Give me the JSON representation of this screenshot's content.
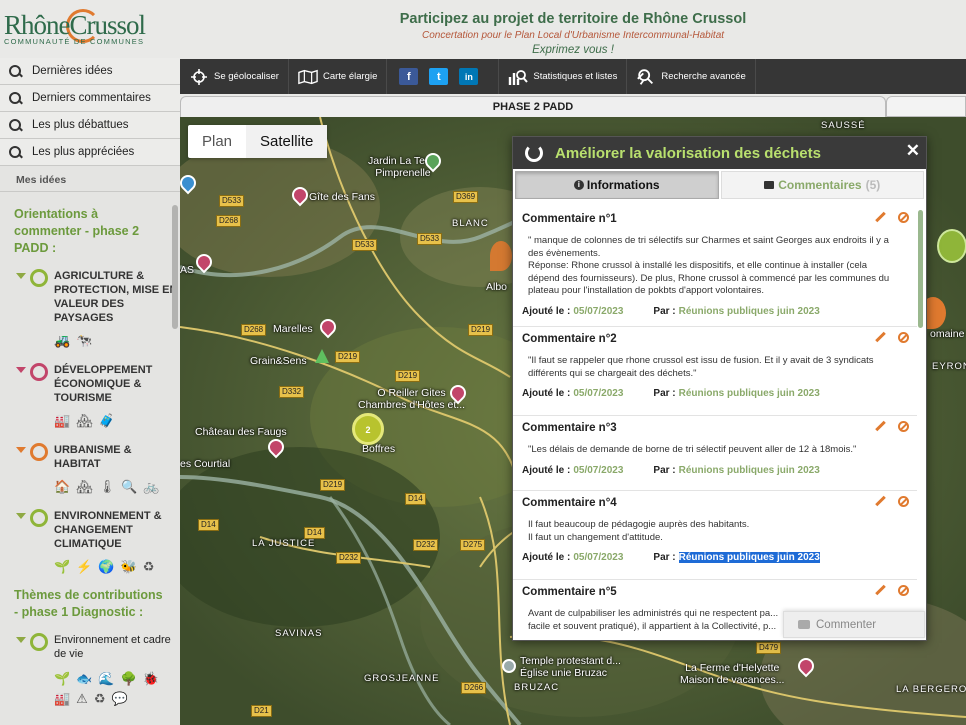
{
  "logo": {
    "brand": "RhôneCrussol",
    "sub": "COMMUNAUTÉ DE COMMUNES"
  },
  "header": {
    "title": "Participez au projet de territoire de Rhône Crussol",
    "subtitle": "Concertation pour le Plan Local d'Urbanisme Intercommunal-Habitat",
    "tagline": "Exprimez vous !"
  },
  "sidebar": {
    "menu": [
      "Dernières idées",
      "Derniers commentaires",
      "Les plus débattues",
      "Les plus appréciées"
    ],
    "mes_idees": "Mes idées",
    "section1_title": "Orientations à commenter - phase 2 PADD :",
    "section1_items": [
      {
        "label": "AGRICULTURE & PROTECTION, MISE EN VALEUR DES PAYSAGES",
        "color": "#8fb539",
        "icons": "🚜🐄"
      },
      {
        "label": "DÉVELOPPEMENT ÉCONOMIQUE & TOURISME",
        "color": "#c2456a",
        "icons": "🏭🏘🧳"
      },
      {
        "label": "URBANISME & HABITAT",
        "color": "#e07a2f",
        "icons": "🏠🏘🌡🔍🚲"
      },
      {
        "label": "ENVIRONNEMENT & CHANGEMENT CLIMATIQUE",
        "color": "#8fb539",
        "icons": "🌱⚡🌍🐝♻"
      }
    ],
    "section2_title": "Thèmes de contributions - phase 1 Diagnostic :",
    "section2_items": [
      {
        "label": "Environnement et cadre de vie",
        "color": "#8fb539",
        "icons": "🌱🐟🌊🌳🐞\n🏭⚠♻💬"
      }
    ]
  },
  "toolbar": {
    "geolocate": "Se géolocaliser",
    "carte": "Carte élargie",
    "facebook": "f",
    "twitter": "t",
    "linkedin": "in",
    "stats": "Statistiques et listes",
    "recherche": "Recherche avancée"
  },
  "phase_tab": "PHASE 2 PADD",
  "map": {
    "toggle_plan": "Plan",
    "toggle_satellite": "Satellite",
    "places": {
      "jardin": "Jardin La Terre\nPimprenelle",
      "gite_fans": "Gîte des Fans",
      "blanc": "BLANC",
      "marelles": "Marelles",
      "grain": "Grain&Sens",
      "reiller": "O Reiller Gites\nChambres d'Hôtes et...",
      "chateau": "Château des Faugs",
      "boffres": "Boffres",
      "courtial": "es Courtial",
      "la_justice": "LA JUSTICE",
      "savinas": "SAVINAS",
      "grosjeanne": "GROSJEANNE",
      "bruzac": "BRUZAC",
      "temple": "Temple protestant d...\nÉglise unie Bruzac",
      "ferme": "La Ferme d'Helyette\nMaison de vacances...",
      "saussé": "SAUSSÉ",
      "bergerot": "LA BERGERO",
      "albo": "Albo",
      "as": "AS",
      "domaine": "omaine",
      "eyron": "EYRON"
    },
    "roads": [
      "D533",
      "D369",
      "D268",
      "D533",
      "D533",
      "D268",
      "D219",
      "D219",
      "D332",
      "D219",
      "D14",
      "D14",
      "D14",
      "D232",
      "D232",
      "D275",
      "D266",
      "D21",
      "D479",
      "D232",
      "D219"
    ],
    "cluster_count": "2"
  },
  "panel": {
    "title": "Améliorer la valorisation des déchets",
    "tab_info": "Informations",
    "tab_comments": "Commentaires",
    "tab_comments_count": "(5)",
    "added_label": "Ajouté le :",
    "by_label": "Par :",
    "comments": [
      {
        "title": "Commentaire n°1",
        "text": "\" manque de colonnes de tri sélectifs sur Charmes et saint Georges aux endroits il y a des évènements.\nRéponse: Rhone crussol à installé les dispositifs, et elle continue à installer (cela dépend des fournisseurs). De plus, Rhone crussol à commencé par les communes du plateau pour l'installation de pokbts d'apport volontaires.",
        "date": "05/07/2023",
        "author": "Réunions publiques juin 2023"
      },
      {
        "title": "Commentaire n°2",
        "text": "\"Il faut se rappeler que rhone crussol est issu de fusion. Et il y avait de 3 syndicats différents qui se chargeait des déchets.\"",
        "date": "05/07/2023",
        "author": "Réunions publiques juin 2023"
      },
      {
        "title": "Commentaire n°3",
        "text": "\"Les délais de demande de borne de tri sélectif peuvent aller de 12 à 18mois.\"",
        "date": "05/07/2023",
        "author": "Réunions publiques juin 2023"
      },
      {
        "title": "Commentaire n°4",
        "text": "Il faut beaucoup de pédagogie auprès des habitants.\nIl faut un changement d'attitude.",
        "date": "05/07/2023",
        "author": "Réunions publiques juin 2023"
      },
      {
        "title": "Commentaire n°5",
        "text": "Avant de culpabiliser les administrés qui ne respectent pa...\nfacile et souvent pratiqué), il appartient à la Collectivité, p...",
        "date": "",
        "author": ""
      }
    ],
    "commenter": "Commenter"
  }
}
